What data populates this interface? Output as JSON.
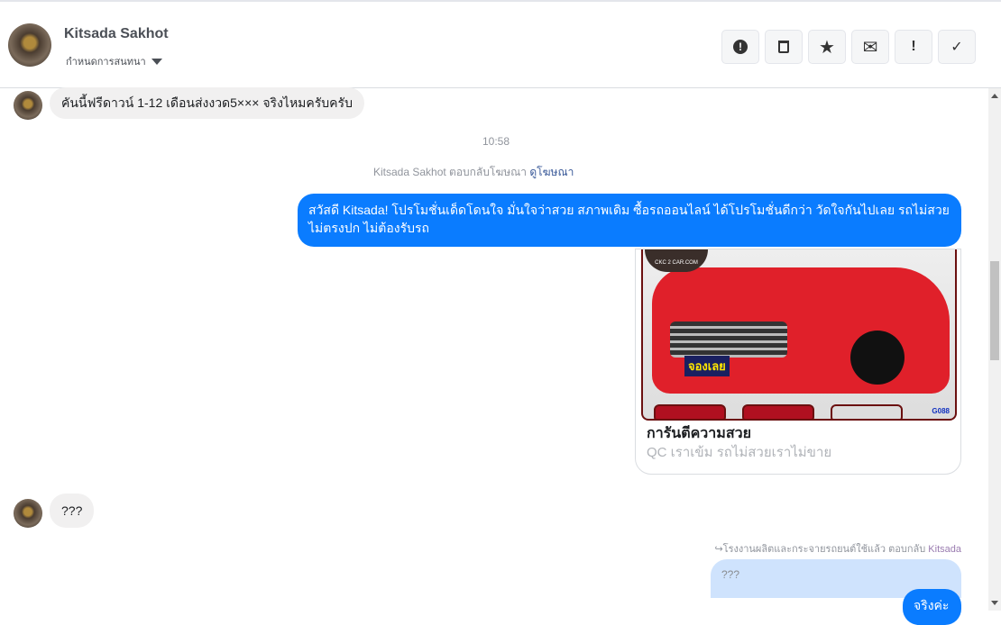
{
  "header": {
    "name": "Kitsada Sakhot",
    "subtitle": "กำหนดการสนทนา",
    "tools": [
      {
        "icon": "alert-circle-icon",
        "glyph": "❗"
      },
      {
        "icon": "trash-icon",
        "glyph": "🗑"
      },
      {
        "icon": "star-icon",
        "glyph": "★"
      },
      {
        "icon": "envelope-icon",
        "glyph": "✉"
      },
      {
        "icon": "exclamation-icon",
        "glyph": "!"
      },
      {
        "icon": "check-icon",
        "glyph": "✓"
      }
    ]
  },
  "messages": {
    "incoming1": "คันนี้ฟรีดาวน์ 1-12 เดือนส่งงวด5××× จริงไหมครับครับ",
    "time": "10:58",
    "ad_reply_prefix": "Kitsada Sakhot ตอบกลับโฆษณา",
    "ad_reply_link": "ดูโฆษณา",
    "outgoing1": "สวัสดี Kitsada! โปรโมชั่นเด็ดโดนใจ มั่นใจว่าสวย สภาพเดิม ซื้อรถออนไลน์ ได้โปรโมชั่นดีกว่า วัดใจกันไปเลย รถไม่สวย ไม่ตรงปก ไม่ต้องรับรถ",
    "card": {
      "logo": "CKC 2 CAR.COM",
      "badge": "จองเลย",
      "code": "G088",
      "title": "การันตีความสวย",
      "description": "QC เราเข้ม รถไม่สวยเราไม่ขาย"
    },
    "incoming2": "???",
    "forward_note": "โรงงานผลิตและกระจายรถยนต์ใช้แล้ว ตอบกลับ",
    "forward_name": "Kitsada",
    "quoted": "???",
    "reply": "จริงค่ะ"
  }
}
